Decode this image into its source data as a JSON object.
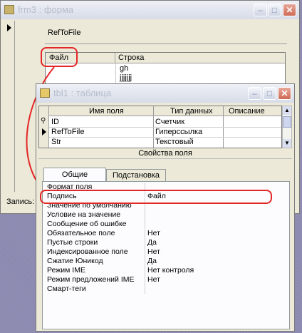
{
  "form_window": {
    "title": "frm3 : форма",
    "field_label": "RefToFile",
    "grid_headers": [
      "Файл",
      "Строка"
    ],
    "grid_values": [
      "gh",
      "jjjjjjj"
    ],
    "status_label": "Запись:"
  },
  "table_window": {
    "title": "tbl1 : таблица",
    "columns": [
      "Имя поля",
      "Тип данных",
      "Описание"
    ],
    "rows": [
      {
        "name": "ID",
        "type": "Счетчик"
      },
      {
        "name": "RefToFile",
        "type": "Гиперссылка"
      },
      {
        "name": "Str",
        "type": "Текстовый"
      }
    ],
    "properties_header": "Свойства поля",
    "tabs": [
      "Общие",
      "Подстановка"
    ],
    "properties": [
      {
        "name": "Формат поля",
        "value": ""
      },
      {
        "name": "Подпись",
        "value": "Файл"
      },
      {
        "name": "Значение по умолчанию",
        "value": ""
      },
      {
        "name": "Условие на значение",
        "value": ""
      },
      {
        "name": "Сообщение об ошибке",
        "value": ""
      },
      {
        "name": "Обязательное поле",
        "value": "Нет"
      },
      {
        "name": "Пустые строки",
        "value": "Да"
      },
      {
        "name": "Индексированное поле",
        "value": "Нет"
      },
      {
        "name": "Сжатие Юникод",
        "value": "Да"
      },
      {
        "name": "Режим IME",
        "value": "Нет контроля"
      },
      {
        "name": "Режим предложений IME",
        "value": "Нет"
      },
      {
        "name": "Смарт-теги",
        "value": ""
      }
    ]
  },
  "colors": {
    "highlight": "#e32626",
    "title_text": "#b7bdcc"
  }
}
